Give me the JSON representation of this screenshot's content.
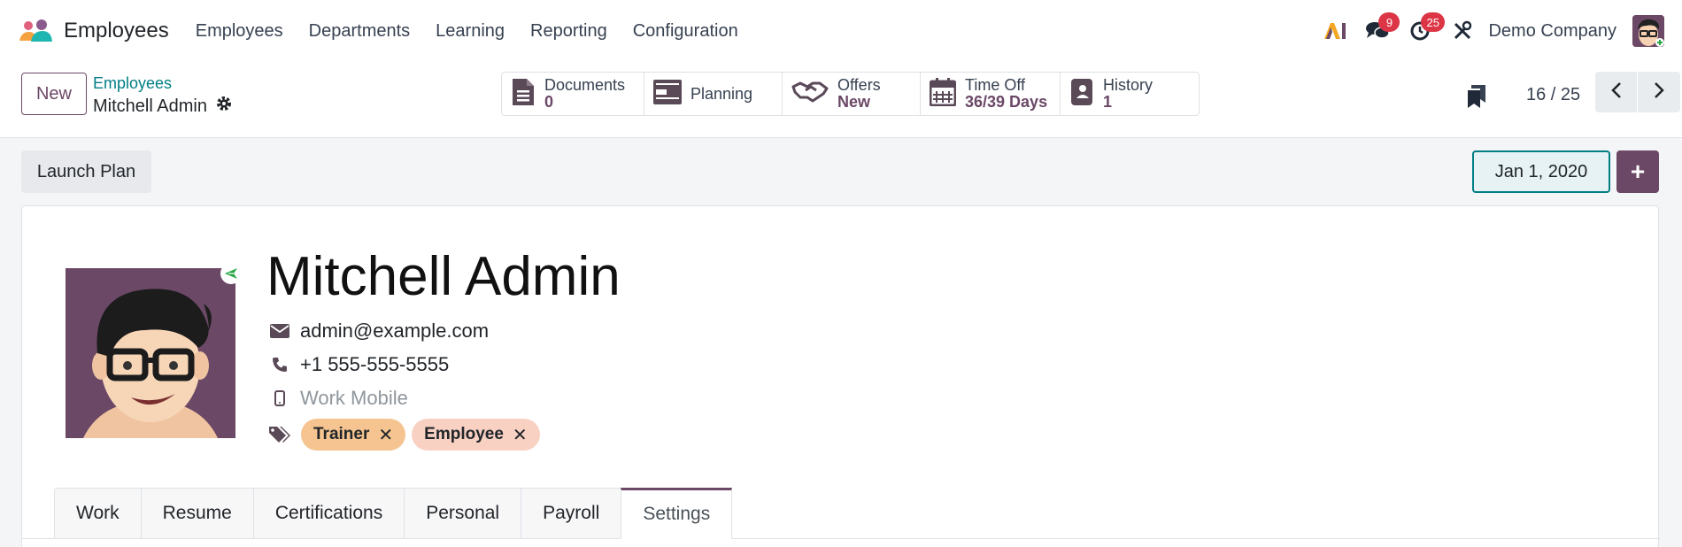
{
  "navbar": {
    "app_title": "Employees",
    "menu": [
      "Employees",
      "Departments",
      "Learning",
      "Reporting",
      "Configuration"
    ],
    "messages_badge": "9",
    "activities_badge": "25",
    "company": "Demo Company"
  },
  "control": {
    "new_label": "New",
    "breadcrumb": "Employees",
    "record_name": "Mitchell Admin",
    "smart_buttons": [
      {
        "label": "Documents",
        "value": "0"
      },
      {
        "label": "Planning",
        "value": ""
      },
      {
        "label": "Offers",
        "value": "New"
      },
      {
        "label": "Time Off",
        "value": "36/39 Days"
      },
      {
        "label": "History",
        "value": "1"
      }
    ],
    "pager": "16 / 25"
  },
  "actions": {
    "launch_plan": "Launch Plan",
    "date": "Jan 1, 2020",
    "plus": "+"
  },
  "employee": {
    "name": "Mitchell Admin",
    "email": "admin@example.com",
    "phone": "+1 555-555-5555",
    "mobile_placeholder": "Work Mobile",
    "tags": [
      "Trainer",
      "Employee"
    ]
  },
  "tabs": [
    "Work",
    "Resume",
    "Certifications",
    "Personal",
    "Payroll",
    "Settings"
  ],
  "colors": {
    "brand": "#6b4866",
    "link": "#017e84",
    "badge": "#dc3545",
    "tag_trainer": "#f5c490",
    "tag_employee": "#f8d1c2"
  }
}
